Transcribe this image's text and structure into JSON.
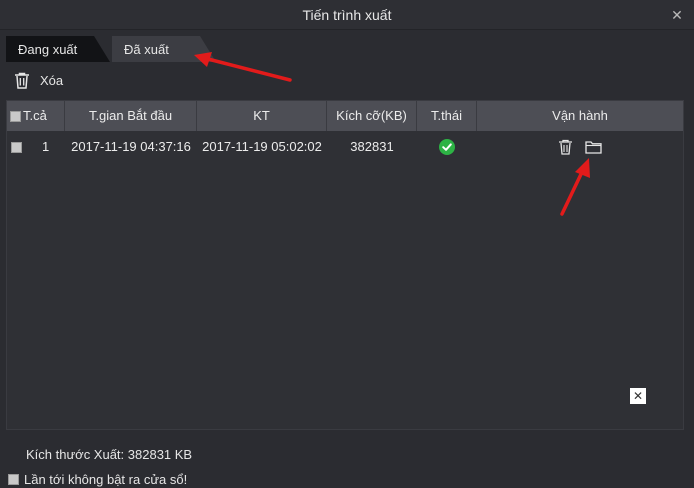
{
  "window": {
    "title": "Tiến trình xuất"
  },
  "tabs": [
    {
      "label": "Đang xuất",
      "active": false
    },
    {
      "label": "Đã xuất",
      "active": true
    }
  ],
  "toolbar": {
    "delete_label": "Xóa",
    "delete_icon": "trash-icon"
  },
  "table": {
    "headers": [
      "T.cả",
      "T.gian Bắt đầu",
      "KT",
      "Kích cỡ(KB)",
      "T.thái",
      "Vận hành"
    ],
    "rows": [
      {
        "index": "1",
        "start": "2017-11-19 04:37:16",
        "end": "2017-11-19 05:02:02",
        "size": "382831",
        "status": "success"
      }
    ]
  },
  "footer": {
    "export_size": "Kích thước Xuất: 382831 KB",
    "no_popup_label": "Lần tới không bật ra cửa sổ!"
  },
  "colors": {
    "background": "#2b2c31",
    "header": "#4d4e55",
    "status_ok": "#2db345",
    "annotation_arrow": "#e21b1b"
  }
}
